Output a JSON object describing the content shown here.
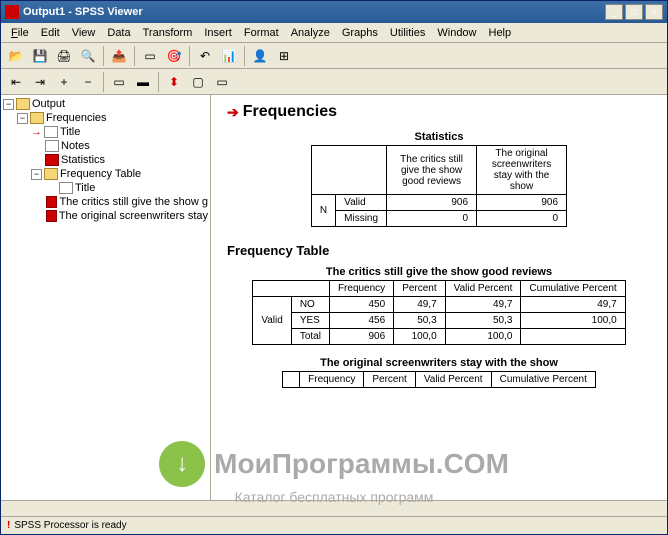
{
  "window": {
    "title": "Output1 - SPSS Viewer"
  },
  "window_buttons": {
    "min": "_",
    "max": "□",
    "close": "×"
  },
  "menubar": [
    "File",
    "Edit",
    "View",
    "Data",
    "Transform",
    "Insert",
    "Format",
    "Analyze",
    "Graphs",
    "Utilities",
    "Window",
    "Help"
  ],
  "tree": {
    "root": "Output",
    "frequencies": "Frequencies",
    "title1": "Title",
    "notes": "Notes",
    "statistics": "Statistics",
    "freq_table": "Frequency Table",
    "title2": "Title",
    "item1": "The critics still give the show g",
    "item2": "The original screenwriters stay"
  },
  "content": {
    "section": "Frequencies",
    "stats_title": "Statistics",
    "stats_cols": [
      "The critics still give the show good reviews",
      "The original screenwriters stay with the show"
    ],
    "stats_rows": {
      "n_label": "N",
      "valid_label": "Valid",
      "missing_label": "Missing",
      "valid": [
        "906",
        "906"
      ],
      "missing": [
        "0",
        "0"
      ]
    },
    "freq_section": "Frequency Table",
    "table1": {
      "title": "The critics still give the show good reviews",
      "headers": [
        "",
        "Frequency",
        "Percent",
        "Valid Percent",
        "Cumulative Percent"
      ],
      "group": "Valid",
      "rows": [
        {
          "label": "NO",
          "freq": "450",
          "pct": "49,7",
          "vpct": "49,7",
          "cpct": "49,7"
        },
        {
          "label": "YES",
          "freq": "456",
          "pct": "50,3",
          "vpct": "50,3",
          "cpct": "100,0"
        },
        {
          "label": "Total",
          "freq": "906",
          "pct": "100,0",
          "vpct": "100,0",
          "cpct": ""
        }
      ]
    },
    "table2": {
      "title": "The original screenwriters stay with the show",
      "headers": [
        "",
        "Frequency",
        "Percent",
        "Valid Percent",
        "Cumulative Percent"
      ]
    }
  },
  "statusbar": {
    "text": "SPSS Processor  is ready"
  },
  "watermark": {
    "line1": "МоиПрограммы.COM",
    "line2": "Каталог бесплатных программ",
    "arrow": "↓"
  }
}
